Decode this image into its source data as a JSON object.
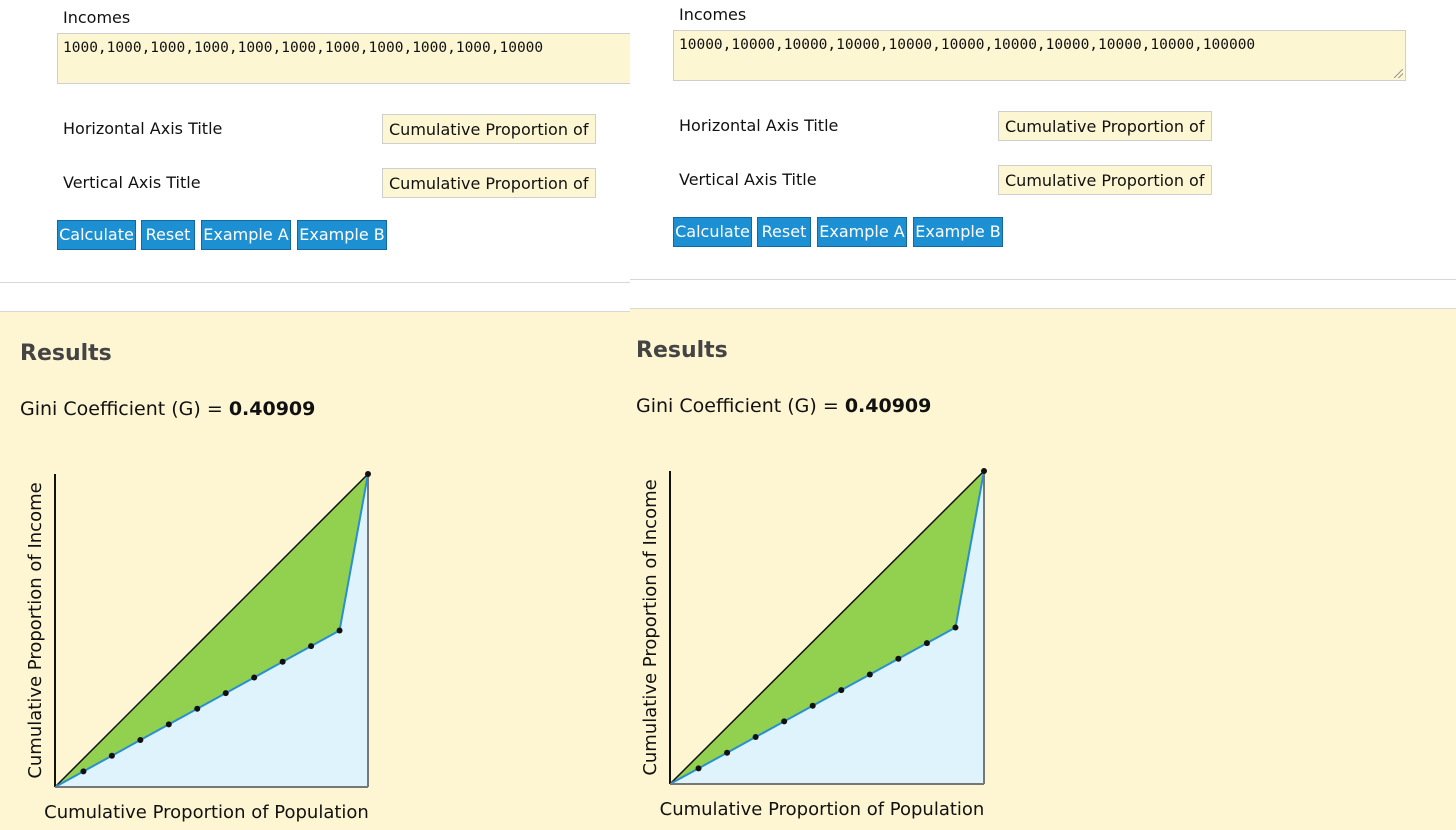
{
  "left": {
    "form": {
      "incomes_label": "Incomes",
      "incomes_value": "1000,1000,1000,1000,1000,1000,1000,1000,1000,1000,10000",
      "h_axis_label": "Horizontal Axis Title",
      "h_axis_value": "Cumulative Proportion of Population",
      "v_axis_label": "Vertical Axis Title",
      "v_axis_value": "Cumulative Proportion of Income",
      "buttons": {
        "calculate": "Calculate",
        "reset": "Reset",
        "example_a": "Example A",
        "example_b": "Example B"
      }
    },
    "results": {
      "title": "Results",
      "gini_label": "Gini Coefficient (G) = ",
      "gini_value": "0.40909"
    }
  },
  "right": {
    "form": {
      "incomes_label": "Incomes",
      "incomes_value": "10000,10000,10000,10000,10000,10000,10000,10000,10000,10000,100000",
      "h_axis_label": "Horizontal Axis Title",
      "h_axis_value": "Cumulative Proportion of Population",
      "v_axis_label": "Vertical Axis Title",
      "v_axis_value": "Cumulative Proportion of Income",
      "buttons": {
        "calculate": "Calculate",
        "reset": "Reset",
        "example_a": "Example A",
        "example_b": "Example B"
      }
    },
    "results": {
      "title": "Results",
      "gini_label": "Gini Coefficient (G) = ",
      "gini_value": "0.40909"
    }
  },
  "colors": {
    "button": "#1d8fd3",
    "input_bg": "#fdf6d2",
    "results_bg": "#fef6d3",
    "gini_area": "#92d050",
    "lorenz_area": "#def3fc",
    "lorenz_line": "#2a8fd0"
  },
  "chart_data": [
    {
      "type": "area",
      "xlabel": "Cumulative Proportion of Population",
      "ylabel": "Cumulative Proportion of Income",
      "x": [
        0,
        0.0909,
        0.1818,
        0.2727,
        0.3636,
        0.4545,
        0.5455,
        0.6364,
        0.7273,
        0.8182,
        0.9091,
        1
      ],
      "series": [
        {
          "values": [
            0,
            0.05,
            0.1,
            0.15,
            0.2,
            0.25,
            0.3,
            0.35,
            0.4,
            0.45,
            0.5,
            1
          ]
        },
        {
          "values": [
            0,
            0.0909,
            0.1818,
            0.2727,
            0.3636,
            0.4545,
            0.5455,
            0.6364,
            0.7273,
            0.8182,
            0.9091,
            1
          ]
        }
      ],
      "xlim": [
        0,
        1
      ],
      "ylim": [
        0,
        1
      ]
    },
    {
      "type": "area",
      "xlabel": "Cumulative Proportion of Population",
      "ylabel": "Cumulative Proportion of Income",
      "x": [
        0,
        0.0909,
        0.1818,
        0.2727,
        0.3636,
        0.4545,
        0.5455,
        0.6364,
        0.7273,
        0.8182,
        0.9091,
        1
      ],
      "series": [
        {
          "values": [
            0,
            0.05,
            0.1,
            0.15,
            0.2,
            0.25,
            0.3,
            0.35,
            0.4,
            0.45,
            0.5,
            1
          ]
        },
        {
          "values": [
            0,
            0.0909,
            0.1818,
            0.2727,
            0.3636,
            0.4545,
            0.5455,
            0.6364,
            0.7273,
            0.8182,
            0.9091,
            1
          ]
        }
      ],
      "xlim": [
        0,
        1
      ],
      "ylim": [
        0,
        1
      ]
    }
  ]
}
